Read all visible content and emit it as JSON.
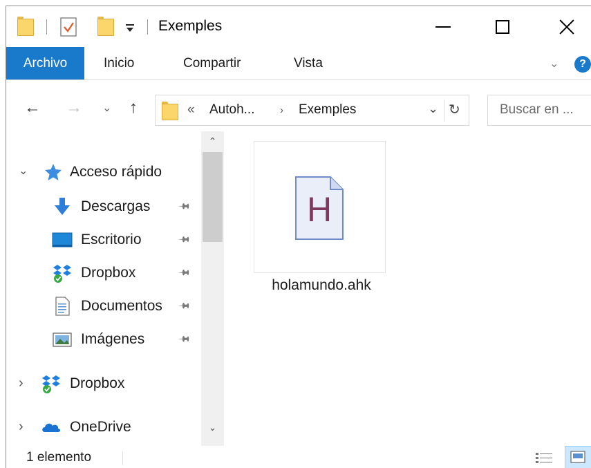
{
  "window": {
    "title": "Exemples"
  },
  "ribbon": {
    "tabs": [
      {
        "label": "Archivo"
      },
      {
        "label": "Inicio"
      },
      {
        "label": "Compartir"
      },
      {
        "label": "Vista"
      }
    ],
    "help_label": "?"
  },
  "address": {
    "overflow": "«",
    "segments": [
      "Autoh...",
      "Exemples"
    ]
  },
  "search": {
    "placeholder": "Buscar en ..."
  },
  "navpane": {
    "quick_access": {
      "label": "Acceso rápido"
    },
    "pinned": [
      {
        "label": "Descargas",
        "icon": "download-icon"
      },
      {
        "label": "Escritorio",
        "icon": "desktop-icon"
      },
      {
        "label": "Dropbox",
        "icon": "dropbox-icon"
      },
      {
        "label": "Documentos",
        "icon": "documents-icon"
      },
      {
        "label": "Imágenes",
        "icon": "images-icon"
      }
    ],
    "roots": [
      {
        "label": "Dropbox",
        "icon": "dropbox-icon"
      },
      {
        "label": "OneDrive",
        "icon": "onedrive-icon"
      }
    ]
  },
  "content": {
    "files": [
      {
        "name": "holamundo.ahk",
        "icon_letter": "H"
      }
    ]
  },
  "status": {
    "count": "1 elemento"
  },
  "colors": {
    "accent": "#1979ca",
    "folder": "#fbd76b",
    "ahk_letter": "#7b3a5e",
    "selected_view": "#cce8ff"
  }
}
